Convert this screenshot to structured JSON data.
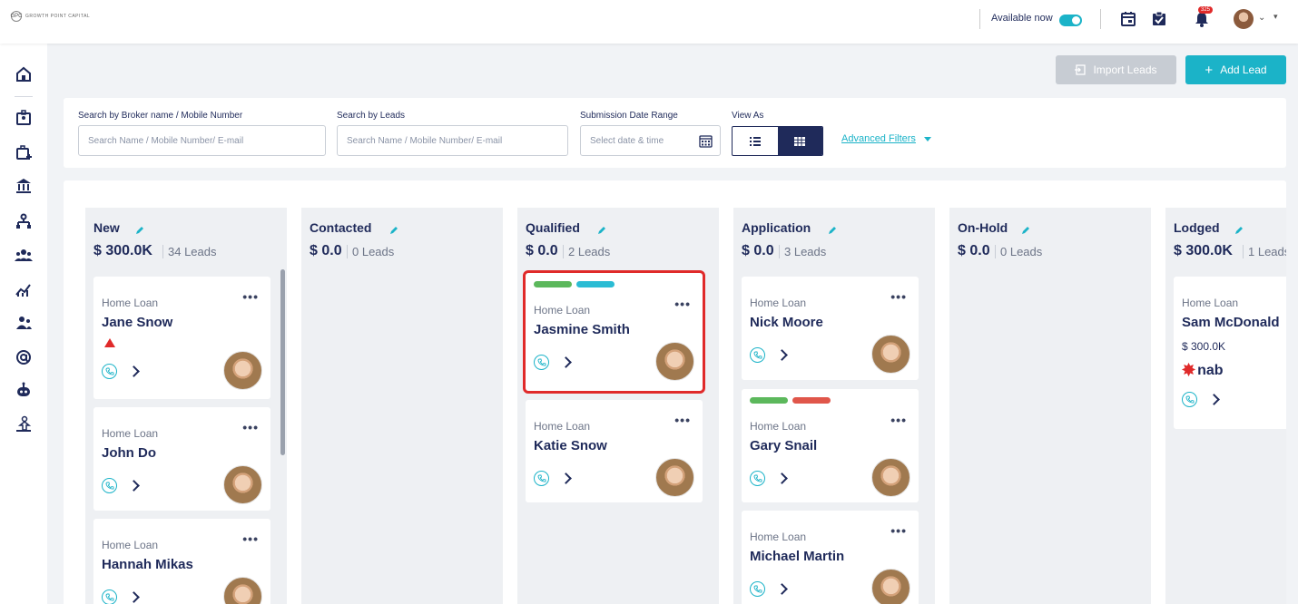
{
  "header": {
    "logo_text": "GROWTH POINT CAPITAL",
    "logo_mark": "GPC",
    "availability_label": "Available now",
    "availability_on": true,
    "notification_count": "325",
    "icons": [
      "calendar-icon",
      "task-check-icon",
      "bell-icon",
      "avatar",
      "chevron-down-icon",
      "caret-down-icon"
    ]
  },
  "sidebar": {
    "items": [
      "home-icon",
      "contact-card-icon",
      "briefcase-add-icon",
      "bank-icon",
      "org-chart-icon",
      "team-icon",
      "chart-icon",
      "users-icon",
      "at-icon",
      "robot-icon",
      "partner-icon"
    ]
  },
  "actions": {
    "import_label": "Import Leads",
    "add_label": "Add Lead",
    "add_prefix": "+"
  },
  "filters": {
    "broker_label": "Search by Broker name / Mobile Number",
    "broker_placeholder": "Search Name / Mobile Number/ E-mail",
    "leads_label": "Search by Leads",
    "leads_placeholder": "Search Name / Mobile Number/ E-mail",
    "date_label": "Submission Date Range",
    "date_placeholder": "Select date & time",
    "view_label": "View As",
    "view_selected": "board",
    "advanced_label": "Advanced Filters"
  },
  "columns": [
    {
      "title": "New",
      "amount": "$ 300.0K",
      "leads": "34 Leads",
      "cards": [
        {
          "type": "Home Loan",
          "name": "Jane Snow",
          "warning": true
        },
        {
          "type": "Home Loan",
          "name": "John Do"
        },
        {
          "type": "Home Loan",
          "name": "Hannah Mikas"
        }
      ]
    },
    {
      "title": "Contacted",
      "amount": "$ 0.0",
      "leads": "0 Leads",
      "cards": []
    },
    {
      "title": "Qualified",
      "amount": "$ 0.0",
      "leads": "2 Leads",
      "cards": [
        {
          "type": "Home Loan",
          "name": "Jasmine Smith",
          "tags": [
            "#5cb85c",
            "#2bbcd4"
          ],
          "selected": true
        },
        {
          "type": "Home Loan",
          "name": "Katie Snow"
        }
      ]
    },
    {
      "title": "Application",
      "amount": "$ 0.0",
      "leads": "3 Leads",
      "cards": [
        {
          "type": "Home Loan",
          "name": "Nick Moore"
        },
        {
          "type": "Home Loan",
          "name": "Gary Snail",
          "tags": [
            "#5cb85c",
            "#e0564a"
          ]
        },
        {
          "type": "Home Loan",
          "name": "Michael Martin"
        }
      ]
    },
    {
      "title": "On-Hold",
      "amount": "$ 0.0",
      "leads": "0 Leads",
      "cards": []
    },
    {
      "title": "Lodged",
      "amount": "$ 300.0K",
      "leads": "1 Leads",
      "cards": [
        {
          "type": "Home Loan",
          "name": "Sam McDonald",
          "amount": "$ 300.0K",
          "lender": "nab"
        }
      ]
    }
  ],
  "colors": {
    "accent": "#1bb3c8",
    "navy": "#1f2a5a",
    "alert": "#e02a2a"
  }
}
